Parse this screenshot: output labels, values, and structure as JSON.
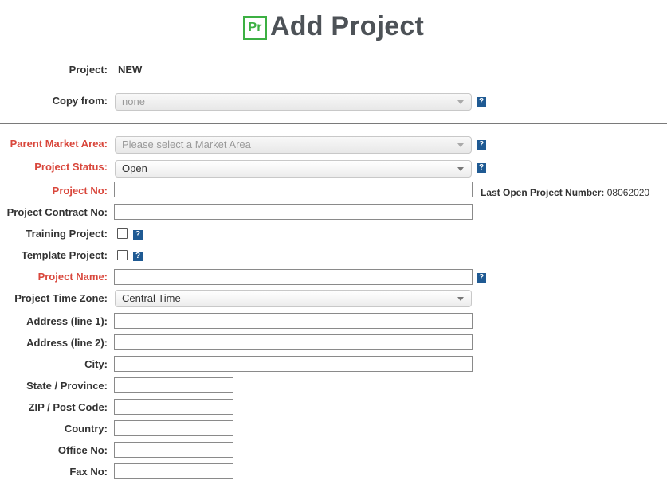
{
  "header": {
    "logo_text": "Pr",
    "title": "Add Project"
  },
  "project": {
    "label": "Project:",
    "value": "NEW"
  },
  "copy_from": {
    "label": "Copy from:",
    "value": "none"
  },
  "help_glyph": "?",
  "parent_market_area": {
    "label": "Parent Market Area:",
    "value": "Please select a Market Area"
  },
  "project_status": {
    "label": "Project Status:",
    "value": "Open"
  },
  "project_no": {
    "label": "Project No:",
    "value": ""
  },
  "last_open": {
    "label": "Last Open Project Number:",
    "value": "08062020"
  },
  "project_contract_no": {
    "label": "Project Contract No:",
    "value": ""
  },
  "training_project": {
    "label": "Training Project:",
    "checked": false
  },
  "template_project": {
    "label": "Template Project:",
    "checked": false
  },
  "project_name": {
    "label": "Project Name:",
    "value": ""
  },
  "time_zone": {
    "label": "Project Time Zone:",
    "value": "Central Time"
  },
  "address1": {
    "label": "Address (line 1):",
    "value": ""
  },
  "address2": {
    "label": "Address (line 2):",
    "value": ""
  },
  "city": {
    "label": "City:",
    "value": ""
  },
  "state": {
    "label": "State / Province:",
    "value": ""
  },
  "zip": {
    "label": "ZIP / Post Code:",
    "value": ""
  },
  "country": {
    "label": "Country:",
    "value": ""
  },
  "office_no": {
    "label": "Office No:",
    "value": ""
  },
  "fax_no": {
    "label": "Fax No:",
    "value": ""
  },
  "colors": {
    "required_label": "#d9473c",
    "accent_logo": "#3cb043",
    "help_badge": "#1f5a93"
  }
}
